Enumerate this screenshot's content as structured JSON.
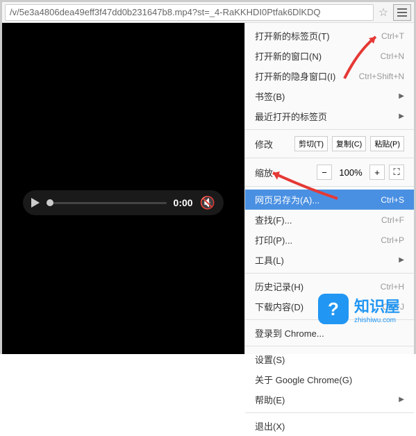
{
  "url": "/v/5e3a4806dea49eff3f47dd0b231647b8.mp4?st=_4-RaKKHDI0Ptfak6DlKDQ",
  "video": {
    "time": "0:00"
  },
  "menu": {
    "new_tab": {
      "label": "打开新的标签页(T)",
      "shortcut": "Ctrl+T"
    },
    "new_window": {
      "label": "打开新的窗口(N)",
      "shortcut": "Ctrl+N"
    },
    "incognito": {
      "label": "打开新的隐身窗口(I)",
      "shortcut": "Ctrl+Shift+N"
    },
    "bookmarks": {
      "label": "书签(B)"
    },
    "recent": {
      "label": "最近打开的标签页"
    },
    "edit": {
      "label": "修改",
      "cut": "剪切(T)",
      "copy": "复制(C)",
      "paste": "粘贴(P)"
    },
    "zoom": {
      "label": "缩放",
      "value": "100%"
    },
    "save_as": {
      "label": "网页另存为(A)...",
      "shortcut": "Ctrl+S"
    },
    "find": {
      "label": "查找(F)...",
      "shortcut": "Ctrl+F"
    },
    "print": {
      "label": "打印(P)...",
      "shortcut": "Ctrl+P"
    },
    "tools": {
      "label": "工具(L)"
    },
    "history": {
      "label": "历史记录(H)",
      "shortcut": "Ctrl+H"
    },
    "downloads": {
      "label": "下载内容(D)",
      "shortcut": "Ctrl+J"
    },
    "signin": {
      "label": "登录到 Chrome..."
    },
    "settings": {
      "label": "设置(S)"
    },
    "about": {
      "label": "关于 Google Chrome(G)"
    },
    "help": {
      "label": "帮助(E)"
    },
    "exit": {
      "label": "退出(X)"
    }
  },
  "logo": {
    "cn": "知识屋",
    "en": "zhishiwu.com"
  }
}
